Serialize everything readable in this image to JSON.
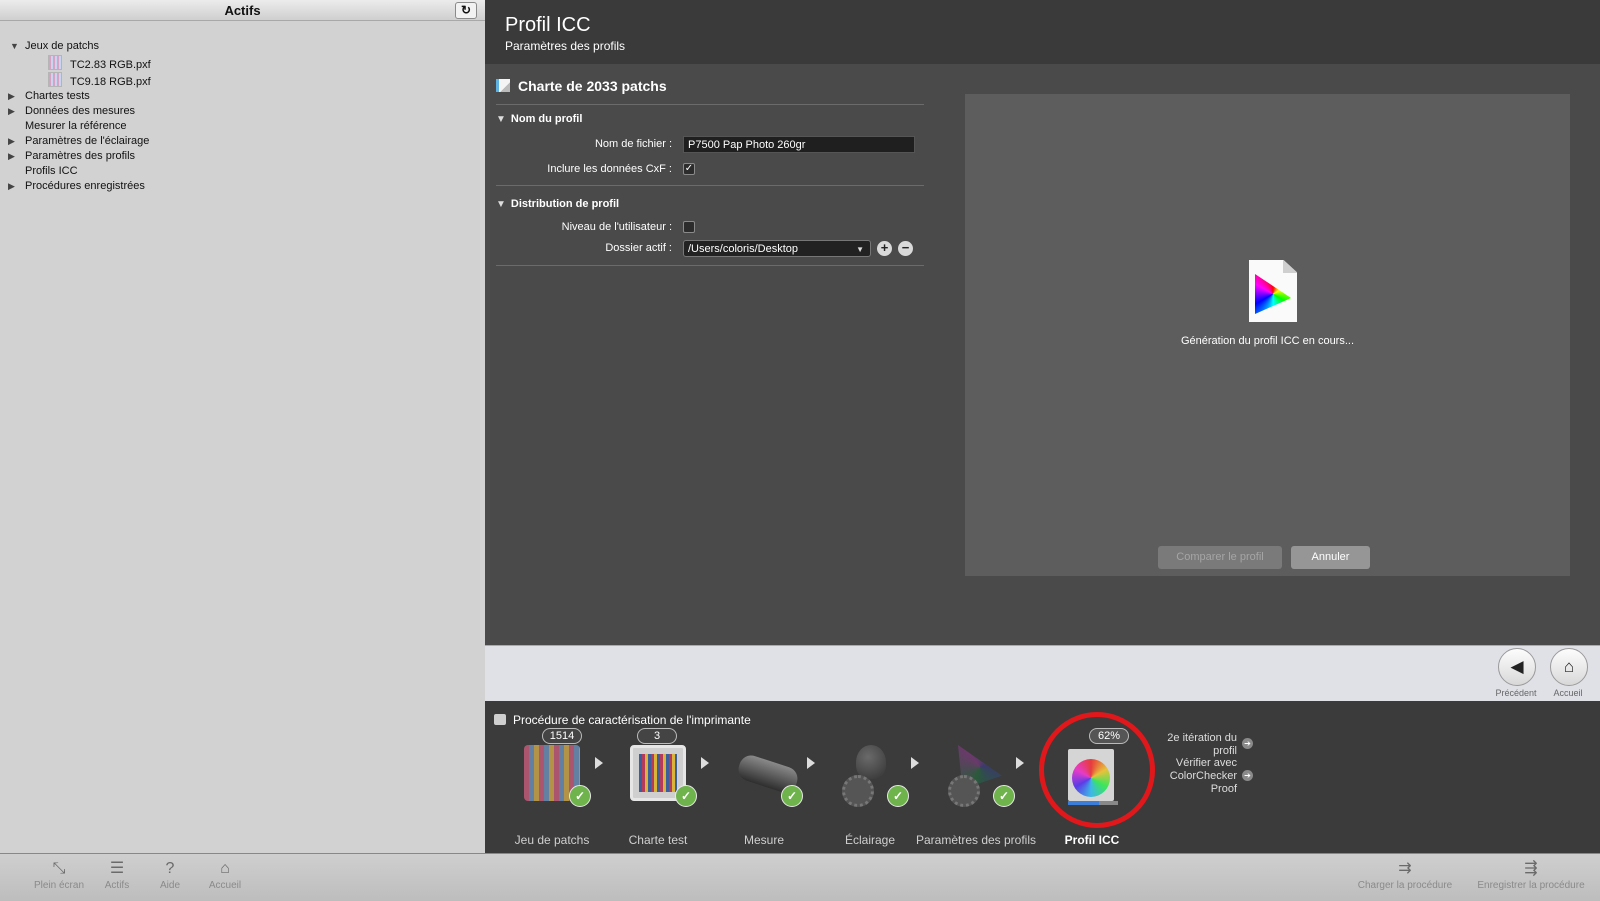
{
  "sidebar": {
    "title": "Actifs",
    "refresh_icon": "refresh-icon",
    "tree": [
      {
        "label": "Jeux de patchs",
        "expanded": true
      },
      {
        "label": "TC2.83 RGB.pxf",
        "child": true
      },
      {
        "label": "TC9.18 RGB.pxf",
        "child": true
      },
      {
        "label": "Chartes tests",
        "expanded": false
      },
      {
        "label": "Données des mesures",
        "expanded": false
      },
      {
        "label": "Mesurer la référence"
      },
      {
        "label": "Paramètres de l'éclairage",
        "expanded": false
      },
      {
        "label": "Paramètres des profils",
        "expanded": false
      },
      {
        "label": "Profils ICC"
      },
      {
        "label": "Procédures enregistrées",
        "expanded": false
      }
    ]
  },
  "header": {
    "title": "Profil ICC",
    "subtitle": "Paramètres des profils"
  },
  "form": {
    "chart_title": "Charte de 2033 patchs",
    "section_profile_name": "Nom du profil",
    "filename_label": "Nom de fichier :",
    "filename_value": "P7500 Pap Photo 260gr",
    "cxf_label": "Inclure les données CxF :",
    "cxf_checked": true,
    "section_distribution": "Distribution de profil",
    "user_level_label": "Niveau de l'utilisateur :",
    "user_level_checked": false,
    "folder_label": "Dossier actif :",
    "folder_value": "/Users/coloris/Desktop"
  },
  "preview": {
    "status_text": "Génération du profil ICC en cours...",
    "compare_button": "Comparer le profil",
    "cancel_button": "Annuler"
  },
  "nav": {
    "back_label": "Précédent",
    "home_label": "Accueil"
  },
  "workflow": {
    "title": "Procédure de caractérisation de l'imprimante",
    "steps": [
      {
        "label": "Jeu de patchs",
        "badge": "1514",
        "done": true
      },
      {
        "label": "Charte test",
        "badge": "3",
        "done": true
      },
      {
        "label": "Mesure",
        "done": true
      },
      {
        "label": "Éclairage",
        "done": true
      },
      {
        "label": "Paramètres des profils",
        "done": true
      },
      {
        "label": "Profil ICC",
        "badge": "62%",
        "active": true,
        "progress": 0.62
      }
    ],
    "next_1": "2e itération du profil",
    "next_2": "Vérifier avec ColorChecker Proof"
  },
  "bottom_bar": {
    "items": [
      "Plein écran",
      "Actifs",
      "Aide",
      "Accueil"
    ],
    "right_items": [
      "Charger la procédure",
      "Enregistrer la procédure"
    ]
  },
  "colors": {
    "highlight": "#e0181c",
    "check": "#6fb34c",
    "sidebar_bg": "#d2d2d2",
    "main_bg": "#4a4a4a"
  }
}
